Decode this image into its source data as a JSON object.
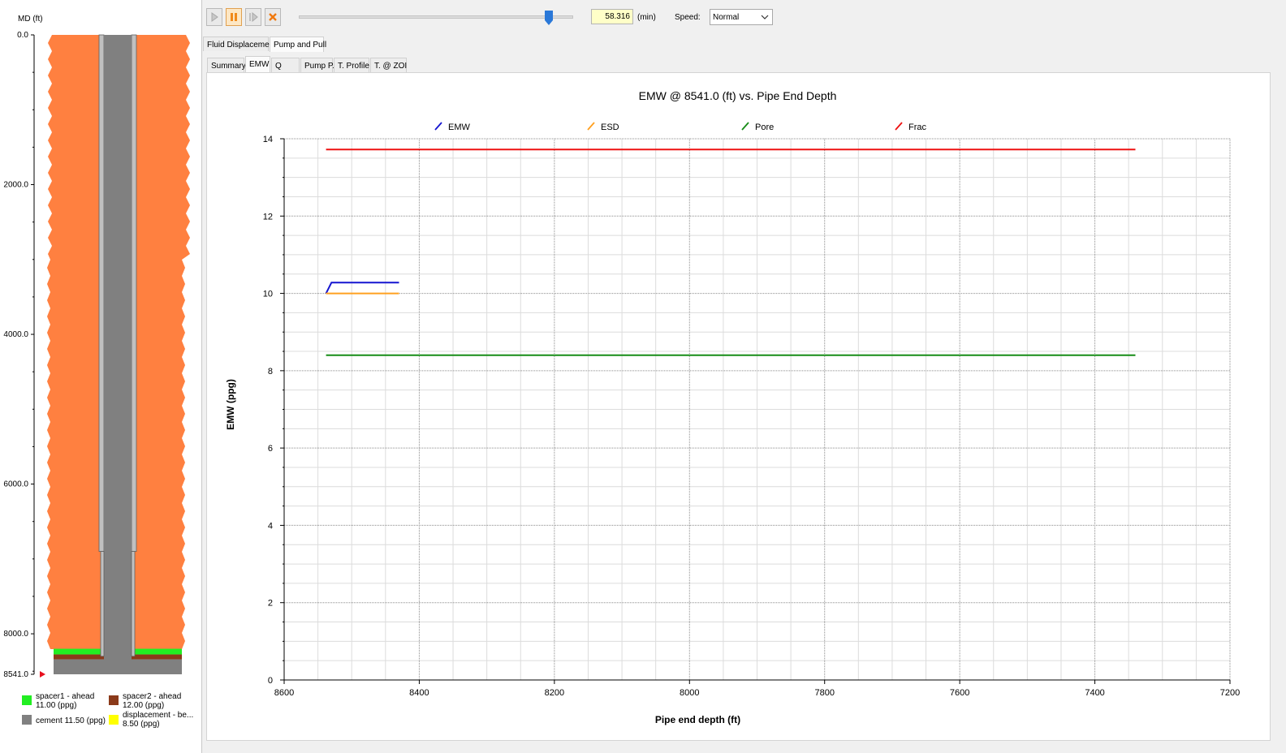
{
  "well": {
    "depth_axis_title": "MD (ft)",
    "depth_ticks": [
      {
        "value": 0,
        "label": "0.0"
      },
      {
        "value": 2000,
        "label": "2000.0"
      },
      {
        "value": 4000,
        "label": "4000.0"
      },
      {
        "value": 6000,
        "label": "6000.0"
      },
      {
        "value": 8000,
        "label": "8000.0"
      },
      {
        "value": 8541,
        "label": "8541.0"
      }
    ],
    "total_depth_ft": 8541,
    "marker_color": "#e8101e",
    "legend": [
      {
        "line1": "spacer1 - ahead",
        "line2": "11.00 (ppg)",
        "color": "#22ee22"
      },
      {
        "line1": "spacer2 - ahead",
        "line2": "12.00 (ppg)",
        "color": "#8b3a1a"
      },
      {
        "line1": "cement 11.50 (ppg)",
        "line2": "",
        "color": "#808080"
      },
      {
        "line1": "displacement - be...",
        "line2": "8.50 (ppg)",
        "color": "#ffff00"
      }
    ],
    "colors": {
      "formation": "#ff8040",
      "pipe": "#808080",
      "casing_wall": "#c0c0c0"
    }
  },
  "toolbar": {
    "time_value": "58.316",
    "time_unit": "(min)",
    "speed_label": "Speed:",
    "speed_value": "Normal",
    "playback_position": 0.9
  },
  "tabs_top": [
    {
      "label": "Fluid Displacement",
      "active": false
    },
    {
      "label": "Pump and Pull",
      "active": true
    }
  ],
  "tabs_sub": [
    {
      "label": "Summary",
      "active": false
    },
    {
      "label": "EMW",
      "active": true
    },
    {
      "label": "Q",
      "active": false
    },
    {
      "label": "Pump P.",
      "active": false
    },
    {
      "label": "T. Profile",
      "active": false
    },
    {
      "label": "T. @ ZOI",
      "active": false
    }
  ],
  "chart_data": {
    "type": "line",
    "title": "EMW @ 8541.0 (ft) vs. Pipe End Depth",
    "xlabel": "Pipe end depth (ft)",
    "ylabel": "EMW (ppg)",
    "xlim": [
      8600,
      7200
    ],
    "ylim": [
      0,
      14
    ],
    "x_reversed": true,
    "xticks": [
      8600,
      8400,
      8200,
      8000,
      7800,
      7600,
      7400,
      7200
    ],
    "yticks": [
      0,
      2,
      4,
      6,
      8,
      10,
      12,
      14
    ],
    "grid": true,
    "legend_position": "top",
    "series": [
      {
        "name": "EMW",
        "color": "#1515d0",
        "x": [
          8538,
          8530,
          8430
        ],
        "y": [
          10.0,
          10.28,
          10.28
        ]
      },
      {
        "name": "ESD",
        "color": "#ffa020",
        "x": [
          8538,
          8430
        ],
        "y": [
          10.0,
          10.0
        ]
      },
      {
        "name": "Pore",
        "color": "#168c16",
        "x": [
          8538,
          7340
        ],
        "y": [
          8.4,
          8.4
        ]
      },
      {
        "name": "Frac",
        "color": "#ee1111",
        "x": [
          8538,
          7340
        ],
        "y": [
          13.72,
          13.72
        ]
      }
    ]
  }
}
